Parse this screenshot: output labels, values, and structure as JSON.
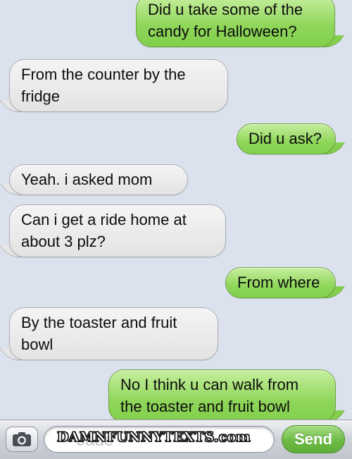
{
  "messages": [
    {
      "direction": "outgoing",
      "text": "Did u take some of the candy for Halloween?"
    },
    {
      "direction": "incoming",
      "text": "From the counter by the fridge"
    },
    {
      "direction": "outgoing",
      "text": "Did u ask?"
    },
    {
      "direction": "incoming",
      "text": "Yeah. i asked mom"
    },
    {
      "direction": "incoming",
      "text": "Can i get a ride home at about 3 plz?"
    },
    {
      "direction": "outgoing",
      "text": "From where"
    },
    {
      "direction": "incoming",
      "text": "By the toaster and fruit bowl"
    },
    {
      "direction": "outgoing",
      "text": "No I think u can walk from the toaster and fruit bowl"
    }
  ],
  "input_bar": {
    "camera_icon": "camera-icon",
    "field_text": "Jade",
    "watermark": "DAMNFUNNYTEXTS.com",
    "send_label": "Send"
  },
  "colors": {
    "background": "#dbe2ed",
    "outgoing_bubble": "#8fd65a",
    "incoming_bubble": "#e6e6e6",
    "send_button": "#6dbb45"
  }
}
